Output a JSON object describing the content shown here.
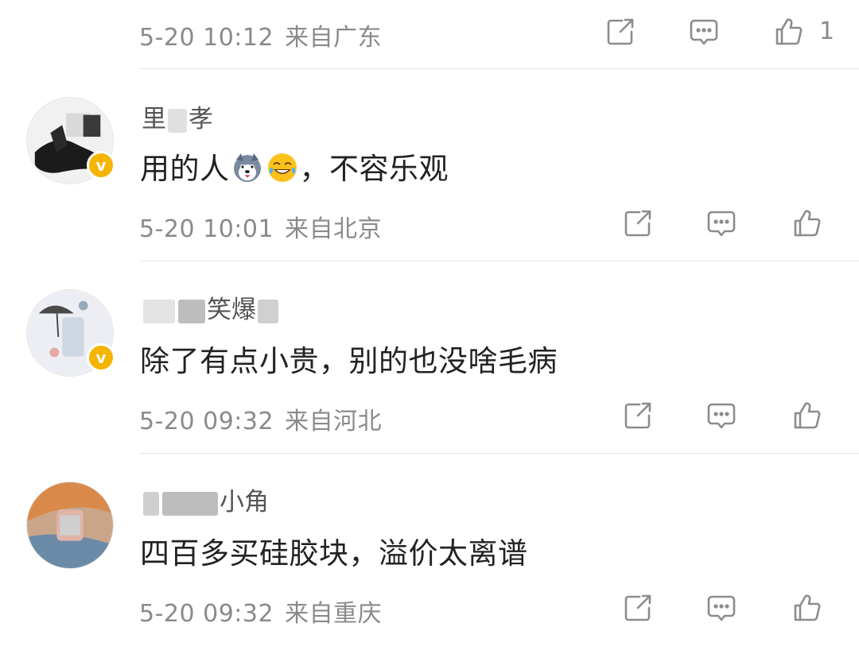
{
  "top": {
    "time": "5-20 10:12",
    "location": "来自广东",
    "like_count": "1"
  },
  "comments": [
    {
      "username_visible_start": "里",
      "username_visible_end": "孝",
      "text_before_emoji": "用的人",
      "text_after_emoji": "，不容乐观",
      "emojis": [
        "husky-dog-emoji",
        "laugh-cry-emoji"
      ],
      "time": "5-20 10:01",
      "location": "来自北京",
      "verified": true
    },
    {
      "username_visible_start": "",
      "username_visible_end": "笑爆",
      "text": "除了有点小贵，别的也没啥毛病",
      "time": "5-20 09:32",
      "location": "来自河北",
      "verified": true
    },
    {
      "username_visible_start": "",
      "username_visible_end": "小角",
      "text": "四百多买硅胶块，溢价太离谱",
      "time": "5-20 09:32",
      "location": "来自重庆",
      "verified": false
    }
  ],
  "icons": {
    "share": "share-icon",
    "comment": "comment-icon",
    "like": "thumbs-up-icon",
    "verified": "verified-badge-icon"
  },
  "colors": {
    "meta_gray": "#8a8a8a",
    "badge_gold": "#f5b400",
    "text_dark": "#222222"
  }
}
